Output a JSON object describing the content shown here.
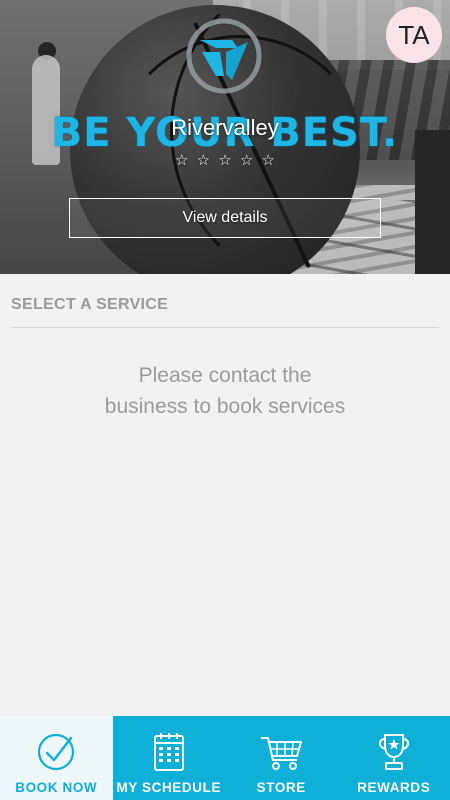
{
  "hero": {
    "slogan": "BE YOUR BEST.",
    "business_name": "Rivervalley",
    "rating_stars": 0,
    "stars": [
      "☆",
      "☆",
      "☆",
      "☆",
      "☆"
    ],
    "view_details_label": "View details"
  },
  "user": {
    "initials": "TA"
  },
  "section": {
    "title": "SELECT A SERVICE",
    "empty_message_line1": "Please contact the",
    "empty_message_line2": "business to book services"
  },
  "nav": {
    "items": [
      {
        "label": "BOOK NOW",
        "icon": "checkmark-circle-icon",
        "active": true
      },
      {
        "label": "MY SCHEDULE",
        "icon": "calendar-icon",
        "active": false
      },
      {
        "label": "STORE",
        "icon": "shopping-cart-icon",
        "active": false
      },
      {
        "label": "REWARDS",
        "icon": "trophy-icon",
        "active": false
      }
    ]
  },
  "colors": {
    "accent": "#10aed6",
    "slogan": "#1fb6e6",
    "nav_active_bg": "#eef8fb",
    "muted_text": "#9b9b9b",
    "avatar_bg": "#fbe3ea"
  }
}
